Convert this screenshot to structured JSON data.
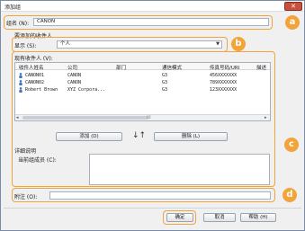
{
  "window": {
    "title": "添加组",
    "close_glyph": "✕"
  },
  "group_name": {
    "label": "组名 (N):",
    "value": "CANON"
  },
  "section_label": "要添加的收件人",
  "display": {
    "label": "显示 (S):",
    "value": "个人"
  },
  "recipients": {
    "label": "现有收件人 (V):",
    "columns": [
      "收件人姓名",
      "公司",
      "部门",
      "通信模式",
      "传真号码/URI",
      "描述"
    ],
    "rows": [
      [
        "CANON01",
        "CANON",
        "",
        "G3",
        "456XXXXXXX",
        ""
      ],
      [
        "CANON02",
        "CANON",
        "",
        "G3",
        "789XXXXXXX",
        ""
      ],
      [
        "Robert Brown",
        "XYZ Corpora...",
        "",
        "G3",
        "123XXXXXXX",
        ""
      ]
    ],
    "scroll_grip": "⁞⁞⁞"
  },
  "add_button": "添加 (D)",
  "swap_glyph": "↓↑",
  "delete_button": "删除 (L)",
  "details_label": "详细说明",
  "members": {
    "label": "当前组成员 (C):"
  },
  "note": {
    "label": "附注 (O):",
    "value": ""
  },
  "ok_button": "确定",
  "cancel_button": "取消",
  "help_button": "帮助 (H)",
  "callouts": [
    "a",
    "b",
    "c",
    "d"
  ],
  "colors": {
    "accent": "#f2a33a",
    "close": "#c7503f"
  },
  "icons": [
    "close-icon",
    "person-icon",
    "arrow-down-up-icon"
  ]
}
